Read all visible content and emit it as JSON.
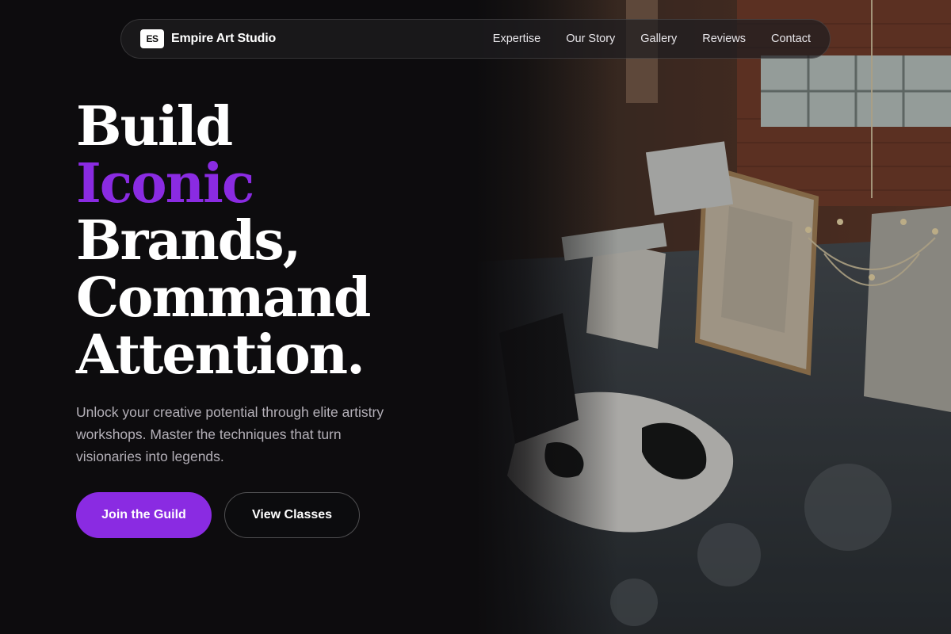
{
  "nav": {
    "logo_mark": "ES",
    "brand_name": "Empire Art Studio",
    "links": [
      "Expertise",
      "Our Story",
      "Gallery",
      "Reviews",
      "Contact"
    ]
  },
  "hero": {
    "headline_lines": [
      "Build",
      "Iconic",
      "Brands,",
      "Command",
      "Attention."
    ],
    "subtitle": "Unlock your creative potential through elite artistry workshops. Master the techniques that turn visionaries into legends.",
    "primary_button": "Join the Guild",
    "secondary_button": "View Classes"
  },
  "colors": {
    "accent": "#8a2be2",
    "background": "#0d0c0e"
  }
}
